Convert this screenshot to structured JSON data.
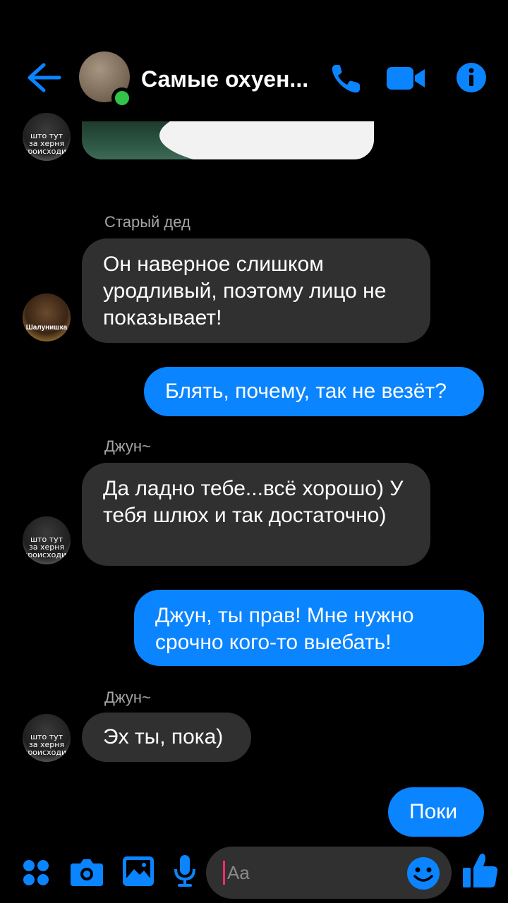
{
  "header": {
    "title": "Самые охуен...",
    "back_icon": "back-arrow-icon",
    "call_icon": "phone-icon",
    "video_icon": "video-camera-icon",
    "info_icon": "info-icon",
    "accent_color": "#0a84ff",
    "online_color": "#31c449"
  },
  "avatars": {
    "jun_caption_1": "што тут",
    "jun_caption_2": "за херня",
    "jun_caption_3": "происходит",
    "shal_caption": "Шалунишка"
  },
  "messages": [
    {
      "sender": "Старый дед",
      "direction": "in",
      "text": "Он наверное слишком уродливый, поэтому лицо не показывает!"
    },
    {
      "direction": "out",
      "text": "Блять, почему, так не везёт?"
    },
    {
      "sender": "Джун~",
      "direction": "in",
      "text": "Да ладно тебе...всё хорошо) У тебя шлюх и так достаточно)"
    },
    {
      "direction": "out",
      "text": "Джун, ты прав! Мне нужно срочно кого-то выебать!"
    },
    {
      "sender": "Джун~",
      "direction": "in",
      "text": "Эх ты, пока)"
    },
    {
      "direction": "out",
      "text": "Поки"
    }
  ],
  "composer": {
    "placeholder": "Aa",
    "menu_icon": "apps-icon",
    "camera_icon": "camera-icon",
    "gallery_icon": "image-icon",
    "mic_icon": "microphone-icon",
    "emoji_icon": "emoji-icon",
    "like_icon": "thumbs-up-icon"
  }
}
